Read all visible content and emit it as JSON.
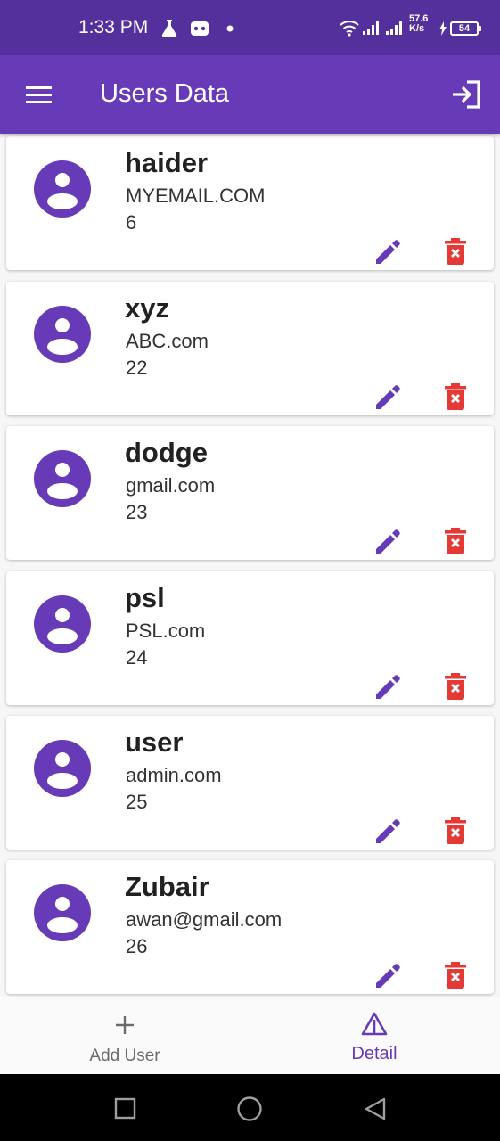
{
  "status_bar": {
    "time": "1:33 PM",
    "net_speed_value": "57.6",
    "net_speed_unit": "K/s",
    "battery": "54",
    "icons": [
      "flask-icon",
      "game-controller-icon",
      "dot-icon",
      "wifi-icon",
      "signal-icon",
      "signal-icon",
      "charging-icon",
      "battery-icon"
    ]
  },
  "app_bar": {
    "title": "Users Data",
    "menu_icon": "hamburger-menu-icon",
    "action_icon": "logout-icon"
  },
  "users": [
    {
      "name": "haider",
      "email": "MYEMAIL.COM",
      "age": "6"
    },
    {
      "name": "xyz",
      "email": "ABC.com",
      "age": "22"
    },
    {
      "name": "dodge",
      "email": "gmail.com",
      "age": "23"
    },
    {
      "name": "psl",
      "email": "PSL.com",
      "age": "24"
    },
    {
      "name": "user",
      "email": "admin.com",
      "age": "25"
    },
    {
      "name": "Zubair",
      "email": "awan@gmail.com",
      "age": "26"
    }
  ],
  "bottom_nav": {
    "items": [
      {
        "label": "Add User",
        "icon": "plus-icon",
        "active": false
      },
      {
        "label": "Detail",
        "icon": "warning-triangle-icon",
        "active": true
      }
    ]
  },
  "colors": {
    "primary": "#673ab7",
    "status_bar": "#53309c",
    "delete": "#e53935",
    "inactive_nav": "#6b6b6b"
  }
}
